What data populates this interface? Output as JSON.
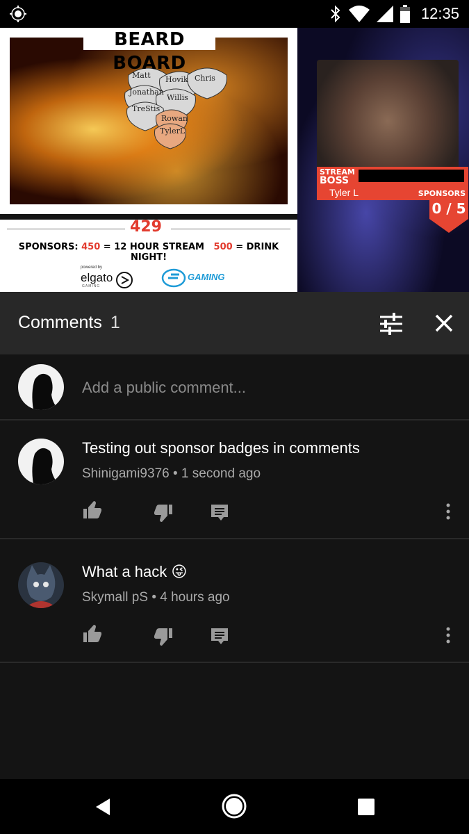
{
  "status_bar": {
    "time": "12:35",
    "icons": [
      "location-icon",
      "bluetooth-icon",
      "wifi-icon",
      "signal-icon",
      "battery-icon"
    ]
  },
  "video": {
    "beard_board_title": "BEARD BOARD",
    "beard_names": [
      "Matt",
      "Hovik",
      "Chris",
      "Jonathan",
      "Willis",
      "TreStis",
      "Rowan",
      "TylerL"
    ],
    "sponsor_count": "429",
    "sponsors_label": "SPONSORS:",
    "goal1_value": "450",
    "goal1_text": "= 12 HOUR STREAM",
    "goal2_value": "500",
    "goal2_text": "= DRINK NIGHT!",
    "powered_by": "powered by",
    "elgato": "elgato",
    "elgato_sub": "GAMING",
    "gaming_logo": "GAMING",
    "stream_boss_label_1": "STREAM",
    "stream_boss_label_2": "BOSS",
    "stream_boss_name": "Tyler L",
    "sponsors_title": "SPONSORS",
    "sponsors_progress": "0 / 5"
  },
  "comments_header": {
    "title": "Comments",
    "count": "1"
  },
  "add_comment": {
    "placeholder": "Add a public comment..."
  },
  "comments": [
    {
      "text": "Testing out sponsor badges in comments",
      "author": "Shinigami9376",
      "separator": "•",
      "time": "1 second ago"
    },
    {
      "text": "What a hack 😜",
      "author": "Skymall pS",
      "separator": "•",
      "time": "4 hours ago"
    }
  ],
  "colors": {
    "background": "#141414",
    "header": "#282828",
    "accent_red": "#e64532"
  }
}
